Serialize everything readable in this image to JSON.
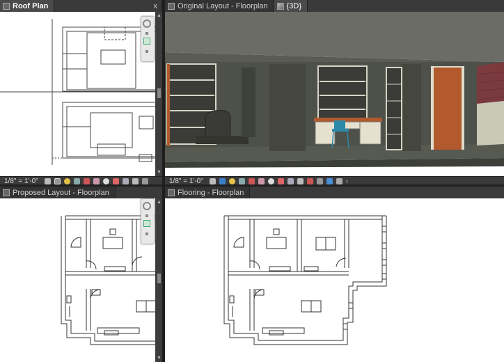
{
  "panes": {
    "roof": {
      "tab_label": "Roof Plan",
      "close_glyph": "x",
      "scale": "1/8\" = 1'-0\""
    },
    "original": {
      "tab_label": "Original Layout - Floorplan",
      "scale": "1/8\" = 1'-0\""
    },
    "threed": {
      "tab_label": "{3D}"
    },
    "proposed": {
      "tab_label": "Proposed Layout - Floorplan"
    },
    "flooring": {
      "tab_label": "Flooring - Floorplan"
    }
  },
  "icons": {
    "view_tab": "floorplan-view-icon",
    "threed_tab": "3d-cube-icon",
    "close": "close-icon",
    "nav_wheel": "steering-wheel-icon",
    "zoom": "zoom-region-icon",
    "scroll_up": "chevron-up-icon",
    "scroll_down": "chevron-down-icon",
    "expand_left": "chevron-left-icon"
  },
  "colors": {
    "chrome": "#3a3a3a",
    "canvas": "#ffffff",
    "floor_3d": "#565a50",
    "wall_3d": "#4e504a",
    "door_3d": "#b25a2d",
    "brick_3d": "#7a3a3e"
  }
}
